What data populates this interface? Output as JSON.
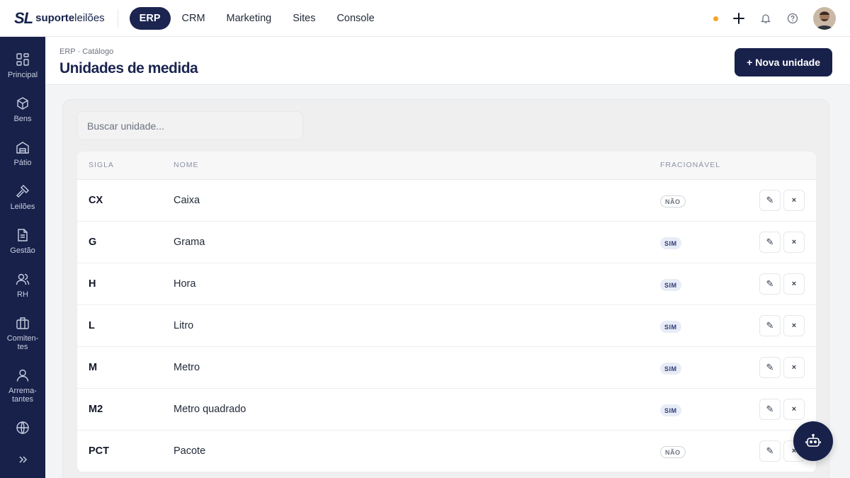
{
  "brand": {
    "mark": "SL",
    "name_bold": "suporte",
    "name_light": "leilões"
  },
  "topnav": [
    {
      "label": "ERP",
      "active": true
    },
    {
      "label": "CRM",
      "active": false
    },
    {
      "label": "Marketing",
      "active": false
    },
    {
      "label": "Sites",
      "active": false
    },
    {
      "label": "Console",
      "active": false
    }
  ],
  "sidebar": {
    "items": [
      {
        "label": "Principal",
        "icon": "dashboard-icon"
      },
      {
        "label": "Bens",
        "icon": "box-icon"
      },
      {
        "label": "Pátio",
        "icon": "warehouse-icon"
      },
      {
        "label": "Leilões",
        "icon": "gavel-icon"
      },
      {
        "label": "Gestão",
        "icon": "document-icon"
      },
      {
        "label": "RH",
        "icon": "users-icon"
      },
      {
        "label": "Comiten-\ntes",
        "icon": "briefcase-icon"
      },
      {
        "label": "Arrema-\ntantes",
        "icon": "user-icon"
      },
      {
        "label": "",
        "icon": "globe-icon"
      }
    ]
  },
  "header": {
    "breadcrumb": "ERP · Catálogo",
    "title": "Unidades de medida",
    "new_button": "+ Nova unidade"
  },
  "search": {
    "placeholder": "Buscar unidade..."
  },
  "table": {
    "columns": [
      "SIGLA",
      "NOME",
      "FRACIONÁVEL"
    ],
    "rows": [
      {
        "sigla": "CX",
        "nome": "Caixa",
        "fracionavel": "NÃO"
      },
      {
        "sigla": "G",
        "nome": "Grama",
        "fracionavel": "SIM"
      },
      {
        "sigla": "H",
        "nome": "Hora",
        "fracionavel": "SIM"
      },
      {
        "sigla": "L",
        "nome": "Litro",
        "fracionavel": "SIM"
      },
      {
        "sigla": "M",
        "nome": "Metro",
        "fracionavel": "SIM"
      },
      {
        "sigla": "M2",
        "nome": "Metro quadrado",
        "fracionavel": "SIM"
      },
      {
        "sigla": "PCT",
        "nome": "Pacote",
        "fracionavel": "NÃO"
      }
    ],
    "edit_glyph": "✎",
    "delete_glyph": "×"
  },
  "colors": {
    "navy": "#18214a",
    "accent_dot": "#f5a623"
  }
}
